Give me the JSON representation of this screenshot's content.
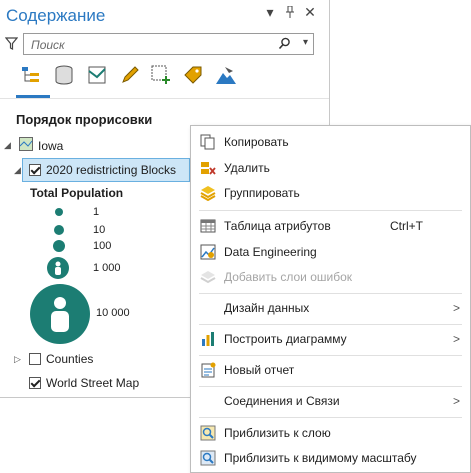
{
  "pane": {
    "title": "Содержание",
    "search_placeholder": "Поиск",
    "section_title": "Порядок прорисовки",
    "map_name": "Iowa",
    "layers": {
      "selected": "2020 redistricting Blocks",
      "counties": "Counties",
      "world": "World Street Map"
    },
    "legend": {
      "title": "Total Population",
      "classes": [
        "1",
        "10",
        "100",
        "1 000",
        "10 000"
      ]
    }
  },
  "menu": {
    "copy": "Копировать",
    "delete": "Удалить",
    "group": "Группировать",
    "attribute_table": "Таблица атрибутов",
    "attribute_table_shortcut": "Ctrl+T",
    "data_engineering": "Data Engineering",
    "add_error_layers": "Добавить слои ошибок",
    "data_design": "Дизайн данных",
    "create_chart": "Построить диаграмму",
    "new_report": "Новый отчет",
    "joins_relates": "Соединения и Связи",
    "zoom_to_layer": "Приблизить к слою",
    "zoom_to_visible_scale": "Приблизить к видимому масштабу"
  },
  "colors": {
    "accent": "#2b79c2",
    "symbol": "#1c7d73",
    "selection": "#cde6f7"
  }
}
